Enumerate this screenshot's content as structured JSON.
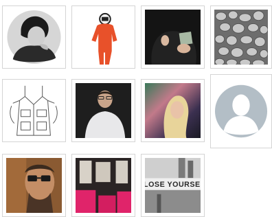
{
  "gallery": {
    "tiles": [
      {
        "row": 1,
        "col": 1,
        "kind": "photo",
        "subject": "portrait-woman-bw-circle"
      },
      {
        "row": 1,
        "col": 2,
        "kind": "photo",
        "subject": "astronaut-figure-orange-suit"
      },
      {
        "row": 1,
        "col": 3,
        "kind": "photo",
        "subject": "hands-holding-small-box"
      },
      {
        "row": 1,
        "col": 4,
        "kind": "photo",
        "subject": "grey-pebble-texture"
      },
      {
        "row": 2,
        "col": 1,
        "kind": "photo",
        "subject": "line-drawing-jacket"
      },
      {
        "row": 2,
        "col": 2,
        "kind": "photo",
        "subject": "man-in-white-shirt"
      },
      {
        "row": 2,
        "col": 3,
        "kind": "photo",
        "subject": "blonde-woman-light-leak"
      },
      {
        "row": 2,
        "col": 4,
        "kind": "placeholder",
        "subject": "default-avatar"
      },
      {
        "row": 3,
        "col": 1,
        "kind": "photo",
        "subject": "man-with-glasses-closeup"
      },
      {
        "row": 3,
        "col": 2,
        "kind": "photo",
        "subject": "pink-interior-room"
      },
      {
        "row": 3,
        "col": 3,
        "kind": "photo",
        "subject": "bw-street-sign",
        "sign_text": "LOSE YOURSELF"
      }
    ],
    "colors": {
      "border": "#d4d4d4",
      "avatar_bg": "#b3bec6",
      "avatar_silhouette": "#ffffff",
      "astronaut_suit": "#e8512a",
      "pink_interior": "#e0246a"
    }
  }
}
